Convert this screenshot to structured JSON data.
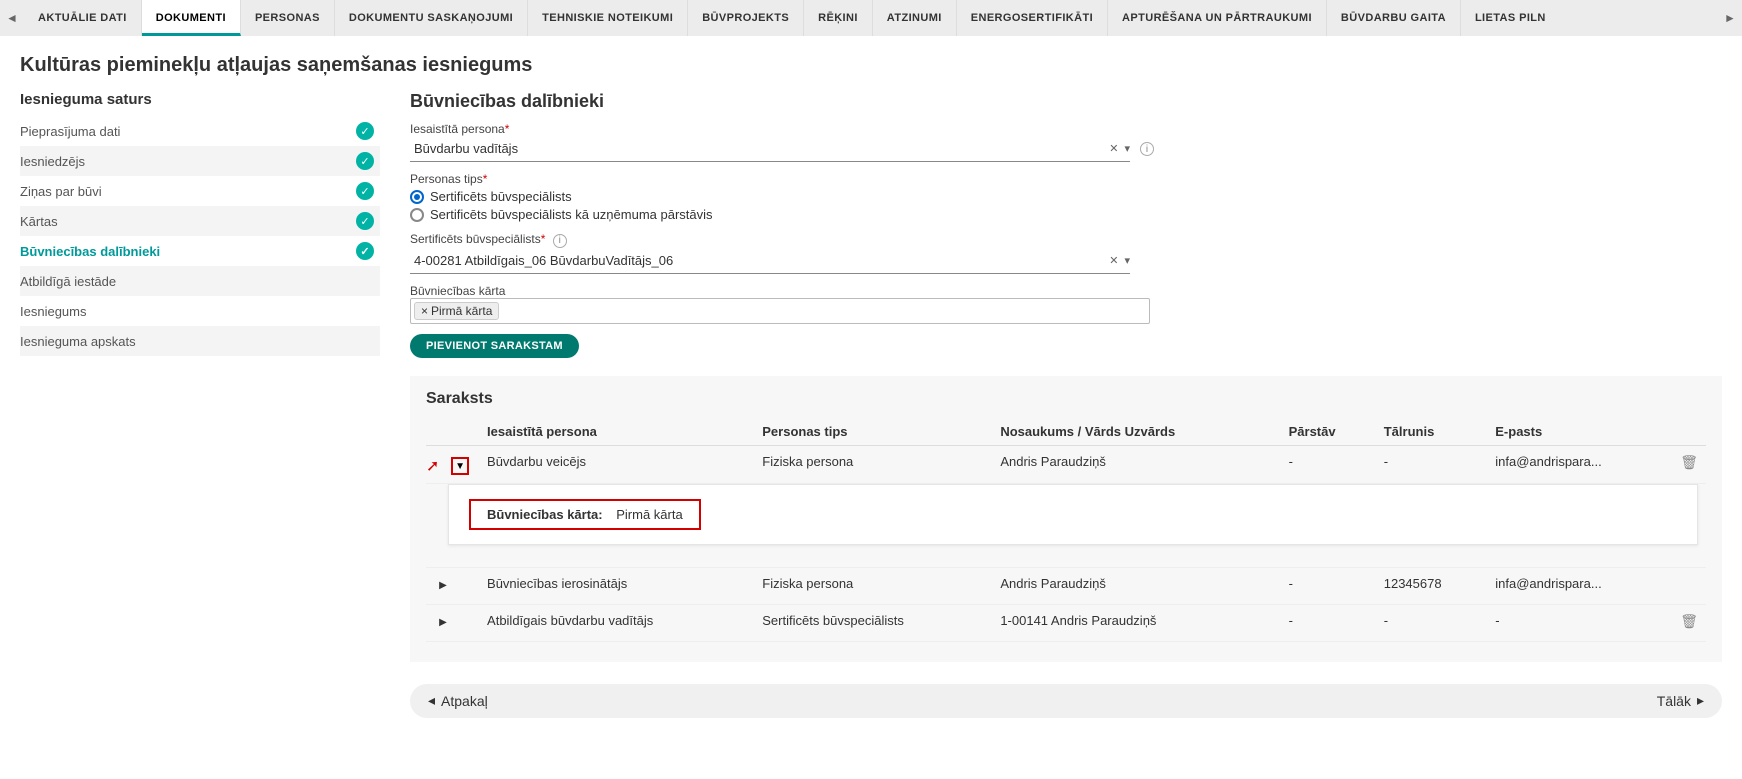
{
  "tabs": [
    "AKTUĀLIE DATI",
    "DOKUMENTI",
    "PERSONAS",
    "DOKUMENTU SASKAŅOJUMI",
    "TEHNISKIE NOTEIKUMI",
    "BŪVPROJEKTS",
    "RĒĶINI",
    "ATZINUMI",
    "ENERGOSERTIFIKĀTI",
    "APTURĒŠANA UN PĀRTRAUKUMI",
    "BŪVDARBU GAITA",
    "LIETAS PILN"
  ],
  "active_tab_index": 1,
  "page_title": "Kultūras pieminekļu atļaujas saņemšanas iesniegums",
  "sidebar": {
    "title": "Iesnieguma saturs",
    "items": [
      {
        "label": "Pieprasījuma dati",
        "done": true
      },
      {
        "label": "Iesniedzējs",
        "done": true
      },
      {
        "label": "Ziņas par būvi",
        "done": true
      },
      {
        "label": "Kārtas",
        "done": true
      },
      {
        "label": "Būvniecības dalībnieki",
        "done": true,
        "selected": true
      },
      {
        "label": "Atbildīgā iestāde",
        "done": false
      },
      {
        "label": "Iesniegums",
        "done": false
      },
      {
        "label": "Iesnieguma apskats",
        "done": false
      }
    ]
  },
  "form": {
    "section_title": "Būvniecības dalībnieki",
    "person_label": "Iesaistītā persona",
    "person_value": "Būvdarbu vadītājs",
    "ptype_label": "Personas tips",
    "ptype_options": [
      {
        "label": "Sertificēts būvspeciālists",
        "checked": true
      },
      {
        "label": "Sertificēts būvspeciālists kā uzņēmuma pārstāvis",
        "checked": false
      }
    ],
    "spec_label": "Sertificēts būvspeciālists",
    "spec_value": "4-00281 Atbildīgais_06 BūvdarbuVadītājs_06",
    "stage_label": "Būvniecības kārta",
    "stage_tag": "Pirmā kārta",
    "add_btn": "PIEVIENOT SARAKSTAM"
  },
  "list": {
    "title": "Saraksts",
    "headers": [
      "Iesaistītā persona",
      "Personas tips",
      "Nosaukums / Vārds Uzvārds",
      "Pārstāv",
      "Tālrunis",
      "E-pasts"
    ],
    "rows": [
      {
        "role": "Būvdarbu veicējs",
        "type": "Fiziska persona",
        "name": "Andris Paraudziņš",
        "represents": "-",
        "phone": "-",
        "email": "infa@andrispara...",
        "deletable": true,
        "expanded": true,
        "detail_label": "Būvniecības kārta:",
        "detail_value": "Pirmā kārta"
      },
      {
        "role": "Būvniecības ierosinātājs",
        "type": "Fiziska persona",
        "name": "Andris Paraudziņš",
        "represents": "-",
        "phone": "12345678",
        "email": "infa@andrispara...",
        "deletable": false
      },
      {
        "role": "Atbildīgais būvdarbu vadītājs",
        "type": "Sertificēts būvspeciālists",
        "name": "1-00141 Andris Paraudziņš",
        "represents": "-",
        "phone": "-",
        "email": "-",
        "deletable": true
      }
    ]
  },
  "nav": {
    "back": "Atpakaļ",
    "next": "Tālāk"
  }
}
